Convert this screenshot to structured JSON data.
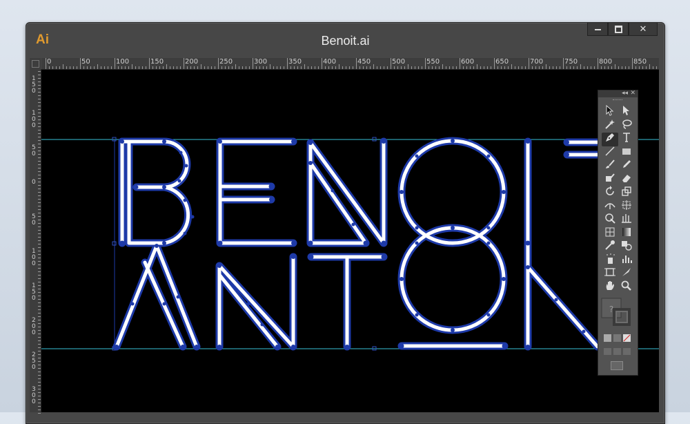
{
  "app": {
    "logo": "Ai",
    "document_title": "Benoit.ai"
  },
  "window_controls": [
    "minimize",
    "maximize",
    "close"
  ],
  "close_glyph": "✕",
  "ruler": {
    "horizontal_labels": [
      "0",
      "50",
      "100",
      "150",
      "200",
      "250",
      "300",
      "350",
      "400",
      "450",
      "500",
      "550",
      "600",
      "650",
      "700",
      "750",
      "800",
      "850"
    ],
    "vertical_labels": [
      "150",
      "100",
      "50",
      "0",
      "50",
      "100",
      "150",
      "200",
      "250",
      "300"
    ]
  },
  "artwork": {
    "line1": [
      "B",
      "E",
      "N",
      "O",
      "I",
      "T"
    ],
    "line2": [
      "A",
      "N",
      "T",
      "O",
      "N"
    ],
    "stroke_color": "#ffffff",
    "selection_color": "#1e3aa8",
    "guide_color": "#39c2d7",
    "background": "#000000"
  },
  "tools_panel": {
    "tools": [
      "selection-tool",
      "direct-selection-tool",
      "magic-wand-tool",
      "lasso-tool",
      "pen-tool",
      "type-tool",
      "line-segment-tool",
      "rectangle-tool",
      "paintbrush-tool",
      "pencil-tool",
      "blob-brush-tool",
      "eraser-tool",
      "rotate-tool",
      "scale-tool",
      "width-tool",
      "free-transform-tool",
      "shape-builder-tool",
      "perspective-grid-tool",
      "mesh-tool",
      "gradient-tool",
      "eyedropper-tool",
      "blend-tool",
      "symbol-sprayer-tool",
      "column-graph-tool",
      "artboard-tool",
      "slice-tool",
      "hand-tool",
      "zoom-tool"
    ],
    "selected_tool": "pen-tool",
    "fill_stroke_hint": "?"
  }
}
